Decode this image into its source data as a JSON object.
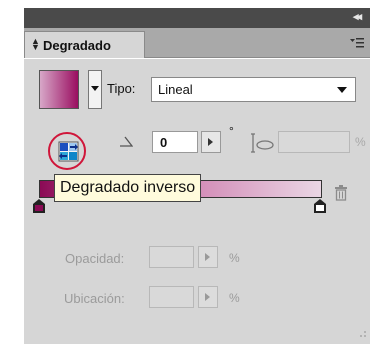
{
  "panel": {
    "title": "Degradado",
    "tab_arrows_icon": "up-down-arrows-icon",
    "collapse_icon": "double-chevron-left-icon",
    "menu_icon": "panel-menu-icon"
  },
  "gradient": {
    "type_label": "Tipo:",
    "type_value": "Lineal",
    "angle_value": "0",
    "degree_symbol": "°",
    "aspect_unit": "%",
    "start_color": "#8b0a55",
    "end_color": "#ffffff"
  },
  "tooltip": {
    "text": "Degradado inverso"
  },
  "stop_fields": {
    "opacity_label": "Opacidad:",
    "opacity_unit": "%",
    "location_label": "Ubicación:",
    "location_unit": "%"
  },
  "colors": {
    "highlight_circle": "#d0163a",
    "panel_bg": "#d6d6d6"
  }
}
